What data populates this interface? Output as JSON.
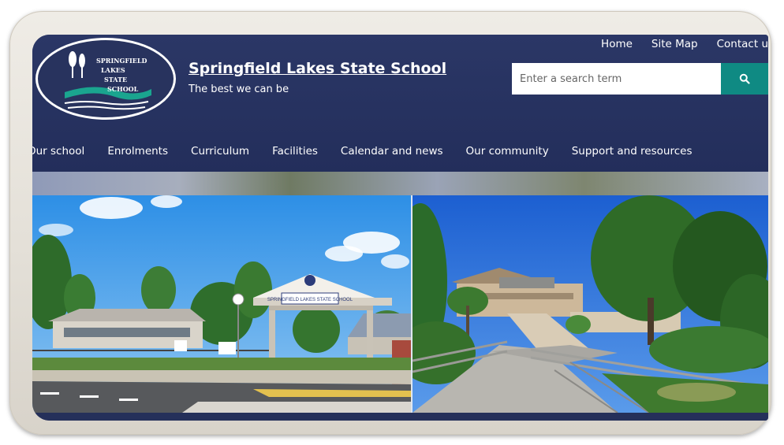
{
  "logo": {
    "lines": [
      "SPRINGFIELD",
      "LAKES",
      "STATE",
      "SCHOOL"
    ]
  },
  "site": {
    "name": "Springfield Lakes State School",
    "tagline": "The best we can be"
  },
  "utility_nav": [
    {
      "label": "Home"
    },
    {
      "label": "Site Map"
    },
    {
      "label": "Contact u"
    }
  ],
  "search": {
    "placeholder": "Enter a search term"
  },
  "main_nav": [
    {
      "label": "Our school"
    },
    {
      "label": "Enrolments"
    },
    {
      "label": "Curriculum"
    },
    {
      "label": "Facilities"
    },
    {
      "label": "Calendar and news"
    },
    {
      "label": "Our community"
    },
    {
      "label": "Support and resources"
    }
  ],
  "photos": {
    "left_sign": "SPRINGFIELD LAKES STATE SCHOOL"
  },
  "colors": {
    "header_bg": "#25305a",
    "search_button": "#0f8a83",
    "logo_wave": "#1aa58f"
  },
  "icons": {
    "search": "search-icon"
  }
}
